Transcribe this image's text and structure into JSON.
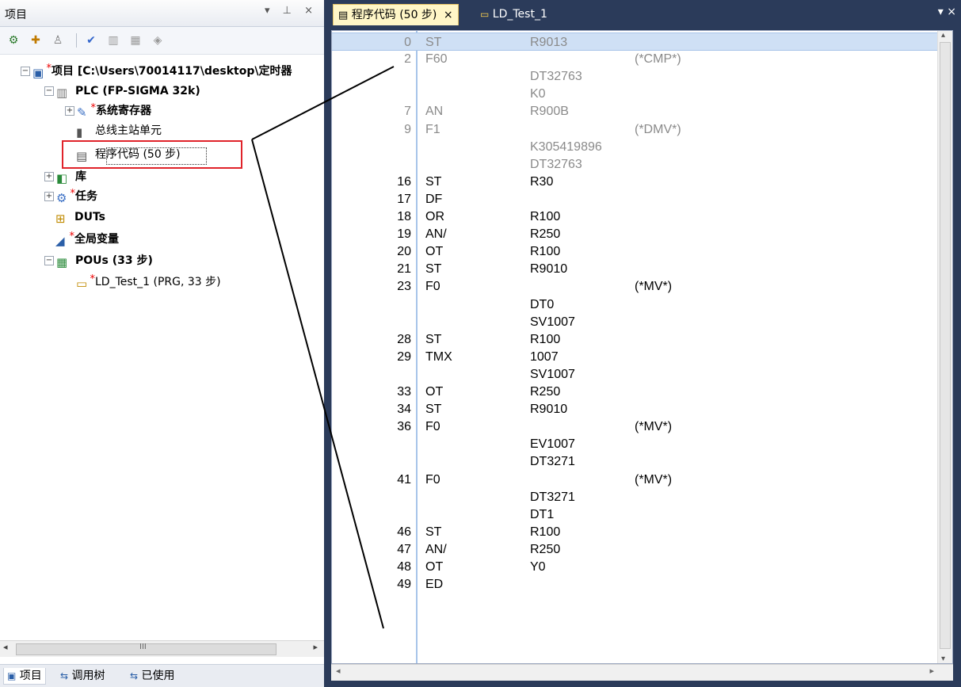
{
  "left_pane": {
    "title": "项目",
    "header_buttons": "▾ ⊥ ×",
    "toolbar_icons": [
      "add-project-icon",
      "add-object-icon",
      "user-icon",
      "check-icon",
      "library-icon",
      "library-add-icon",
      "layers-icon"
    ],
    "tree": [
      {
        "label": "项目 [C:\\Users\\70014117\\desktop\\定时器",
        "bold": true,
        "expander": "⊟",
        "icon": "project-icon",
        "modified": true
      },
      {
        "label": "PLC (FP-SIGMA 32k)",
        "bold": true,
        "expander": "⊟",
        "icon": "plc-icon",
        "modified": false
      },
      {
        "label": "系统寄存器",
        "bold": true,
        "expander": "⊞",
        "icon": "register-icon",
        "modified": true
      },
      {
        "label": "总线主站单元",
        "bold": false,
        "expander": "",
        "icon": "bus-unit-icon",
        "modified": false
      },
      {
        "label": "程序代码 (50 步)",
        "bold": false,
        "expander": "",
        "icon": "code-list-icon",
        "modified": false
      },
      {
        "label": "库",
        "bold": true,
        "expander": "⊞",
        "icon": "library-icon",
        "modified": false
      },
      {
        "label": "任务",
        "bold": true,
        "expander": "⊞",
        "icon": "task-icon",
        "modified": true
      },
      {
        "label": "DUTs",
        "bold": true,
        "expander": "",
        "icon": "dut-icon",
        "modified": false
      },
      {
        "label": "全局变量",
        "bold": true,
        "expander": "",
        "icon": "global-var-icon",
        "modified": true
      },
      {
        "label": "POUs (33 步)",
        "bold": true,
        "expander": "⊟",
        "icon": "pou-icon",
        "modified": false
      },
      {
        "label": "LD_Test_1 (PRG, 33 步)",
        "bold": false,
        "expander": "",
        "icon": "ld-program-icon",
        "modified": true
      }
    ],
    "scroll_glyph": "III",
    "bottom_tabs": [
      {
        "label": "项目",
        "active": true,
        "icon": "project-tab-icon"
      },
      {
        "label": "调用树",
        "active": false,
        "icon": "call-tree-icon"
      },
      {
        "label": "已使用",
        "active": false,
        "icon": "used-icon"
      }
    ]
  },
  "doc_tabs": [
    {
      "label": "程序代码 (50 步)",
      "active": true,
      "close": "×",
      "icon": "code-list-icon"
    },
    {
      "label": "LD_Test_1",
      "active": false,
      "close": "",
      "icon": "ld-program-icon"
    }
  ],
  "doc_tab_controls": "▾ ×",
  "code_lines": [
    {
      "num": "0",
      "op": "ST",
      "arg": "R9013",
      "cmt": "",
      "dim": true,
      "selected": true
    },
    {
      "num": "2",
      "op": "F60",
      "arg": "",
      "cmt": "(*CMP*)",
      "dim": true,
      "selected": false
    },
    {
      "num": "",
      "op": "",
      "arg": "DT32763",
      "cmt": "",
      "dim": true,
      "selected": false
    },
    {
      "num": "",
      "op": "",
      "arg": "K0",
      "cmt": "",
      "dim": true,
      "selected": false
    },
    {
      "num": "7",
      "op": "AN",
      "arg": "R900B",
      "cmt": "",
      "dim": true,
      "selected": false
    },
    {
      "num": "9",
      "op": "F1",
      "arg": "",
      "cmt": "(*DMV*)",
      "dim": true,
      "selected": false
    },
    {
      "num": "",
      "op": "",
      "arg": "K305419896",
      "cmt": "",
      "dim": true,
      "selected": false
    },
    {
      "num": "",
      "op": "",
      "arg": "DT32763",
      "cmt": "",
      "dim": true,
      "selected": false
    },
    {
      "num": "16",
      "op": "ST",
      "arg": "R30",
      "cmt": "",
      "dim": false,
      "selected": false
    },
    {
      "num": "17",
      "op": "DF",
      "arg": "",
      "cmt": "",
      "dim": false,
      "selected": false
    },
    {
      "num": "18",
      "op": "OR",
      "arg": "R100",
      "cmt": "",
      "dim": false,
      "selected": false
    },
    {
      "num": "19",
      "op": "AN/",
      "arg": "R250",
      "cmt": "",
      "dim": false,
      "selected": false
    },
    {
      "num": "20",
      "op": "OT",
      "arg": "R100",
      "cmt": "",
      "dim": false,
      "selected": false
    },
    {
      "num": "21",
      "op": "ST",
      "arg": "R9010",
      "cmt": "",
      "dim": false,
      "selected": false
    },
    {
      "num": "23",
      "op": "F0",
      "arg": "",
      "cmt": "(*MV*)",
      "dim": false,
      "selected": false
    },
    {
      "num": "",
      "op": "",
      "arg": "DT0",
      "cmt": "",
      "dim": false,
      "selected": false
    },
    {
      "num": "",
      "op": "",
      "arg": "SV1007",
      "cmt": "",
      "dim": false,
      "selected": false
    },
    {
      "num": "28",
      "op": "ST",
      "arg": "R100",
      "cmt": "",
      "dim": false,
      "selected": false
    },
    {
      "num": "29",
      "op": "TMX",
      "arg": "1007",
      "cmt": "",
      "dim": false,
      "selected": false
    },
    {
      "num": "",
      "op": "",
      "arg": "SV1007",
      "cmt": "",
      "dim": false,
      "selected": false
    },
    {
      "num": "33",
      "op": "OT",
      "arg": "R250",
      "cmt": "",
      "dim": false,
      "selected": false
    },
    {
      "num": "34",
      "op": "ST",
      "arg": "R9010",
      "cmt": "",
      "dim": false,
      "selected": false
    },
    {
      "num": "36",
      "op": "F0",
      "arg": "",
      "cmt": "(*MV*)",
      "dim": false,
      "selected": false
    },
    {
      "num": "",
      "op": "",
      "arg": "EV1007",
      "cmt": "",
      "dim": false,
      "selected": false
    },
    {
      "num": "",
      "op": "",
      "arg": "DT3271",
      "cmt": "",
      "dim": false,
      "selected": false
    },
    {
      "num": "41",
      "op": "F0",
      "arg": "",
      "cmt": "(*MV*)",
      "dim": false,
      "selected": false
    },
    {
      "num": "",
      "op": "",
      "arg": "DT3271",
      "cmt": "",
      "dim": false,
      "selected": false
    },
    {
      "num": "",
      "op": "",
      "arg": "DT1",
      "cmt": "",
      "dim": false,
      "selected": false
    },
    {
      "num": "46",
      "op": "ST",
      "arg": "R100",
      "cmt": "",
      "dim": false,
      "selected": false
    },
    {
      "num": "47",
      "op": "AN/",
      "arg": "R250",
      "cmt": "",
      "dim": false,
      "selected": false
    },
    {
      "num": "48",
      "op": "OT",
      "arg": "Y0",
      "cmt": "",
      "dim": false,
      "selected": false
    },
    {
      "num": "49",
      "op": "ED",
      "arg": "",
      "cmt": "",
      "dim": false,
      "selected": false
    }
  ],
  "colors": {
    "highlight_box": "#e0232a",
    "dim_text": "#8a8a8a",
    "tab_active_bg": "#fff6c7",
    "chrome_bg": "#2b3b5a"
  }
}
